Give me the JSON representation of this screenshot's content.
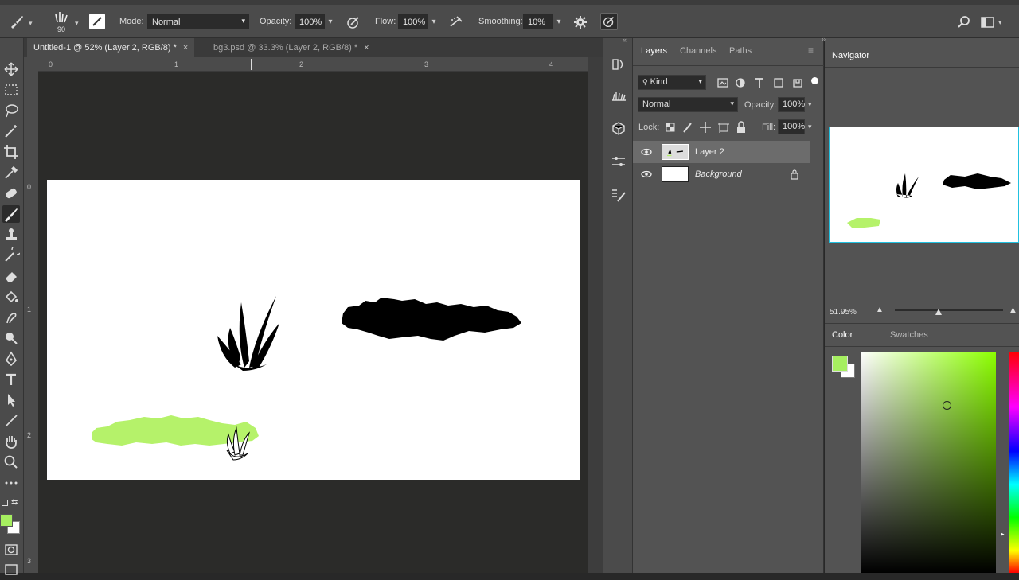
{
  "options": {
    "brush_size": "90",
    "mode_label": "Mode:",
    "mode_value": "Normal",
    "opacity_label": "Opacity:",
    "opacity_value": "100%",
    "flow_label": "Flow:",
    "flow_value": "100%",
    "smoothing_label": "Smoothing:",
    "smoothing_value": "10%"
  },
  "tabs": [
    {
      "label": "Untitled-1 @ 52% (Layer 2, RGB/8) *",
      "close": "×"
    },
    {
      "label": "bg3.psd @ 33.3% (Layer 2, RGB/8) *",
      "close": "×"
    }
  ],
  "ruler": {
    "top": [
      "0",
      "1",
      "2",
      "3",
      "4"
    ],
    "left": [
      "0",
      "1",
      "2",
      "3"
    ]
  },
  "layers_panel": {
    "tabs": [
      "Layers",
      "Channels",
      "Paths"
    ],
    "filter_kind": "Kind",
    "blend_mode": "Normal",
    "opacity_label": "Opacity:",
    "opacity_value": "100%",
    "lock_label": "Lock:",
    "fill_label": "Fill:",
    "fill_value": "100%",
    "layers": [
      {
        "name": "Layer 2",
        "selected": true
      },
      {
        "name": "Background",
        "selected": false,
        "locked": true
      }
    ]
  },
  "navigator": {
    "title": "Navigator",
    "zoom": "51.95%"
  },
  "color_panel": {
    "tabs": [
      "Color",
      "Swatches"
    ],
    "foreground": "#a6ef60",
    "background": "#ffffff"
  },
  "colors": {
    "stroke_green": "#b5f26a",
    "brush_black": "#000000"
  }
}
